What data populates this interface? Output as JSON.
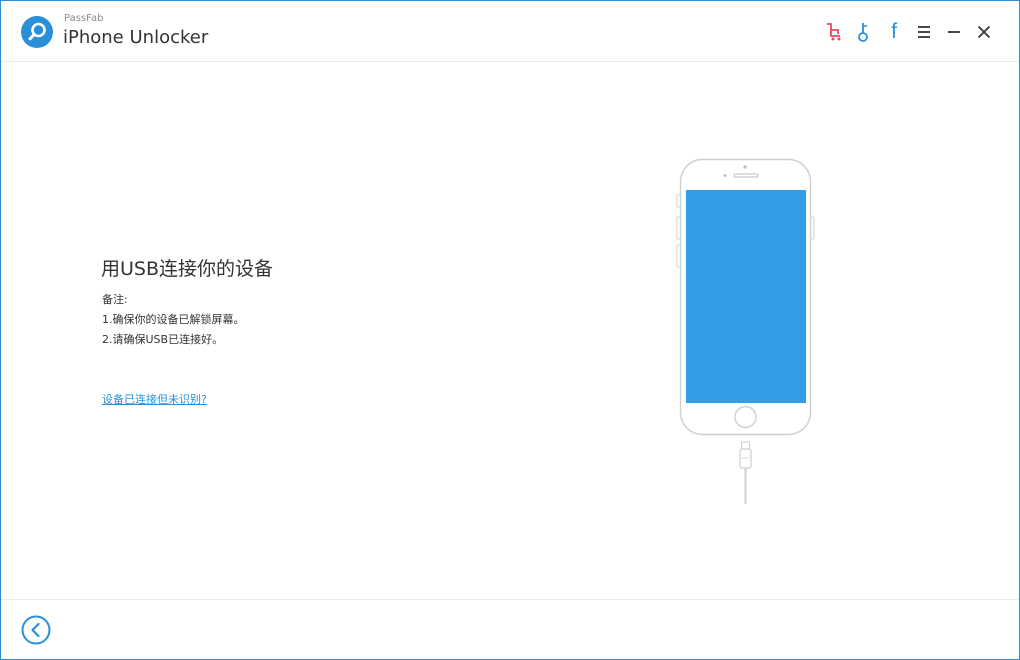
{
  "app": {
    "brand_small": "PassFab",
    "title": "iPhone Unlocker"
  },
  "header": {
    "icons": [
      "cart-icon",
      "key-icon",
      "facebook-icon",
      "menu-icon",
      "minimize-icon",
      "close-icon"
    ],
    "colors": {
      "cart": "#e84a5f",
      "accent": "#2b8fd8",
      "dark": "#333333"
    },
    "facebook_glyph": "f"
  },
  "main": {
    "title": "用USB连接你的设备",
    "note_label": "备注:",
    "notes": [
      "1.确保你的设备已解锁屏幕。",
      "2.请确保USB已连接好。"
    ],
    "help_link": "设备已连接但未识别?"
  },
  "device": {
    "screen_color": "#339ee8",
    "body_color": "#ffffff"
  },
  "footer": {
    "back_icon": "back-arrow-icon"
  }
}
